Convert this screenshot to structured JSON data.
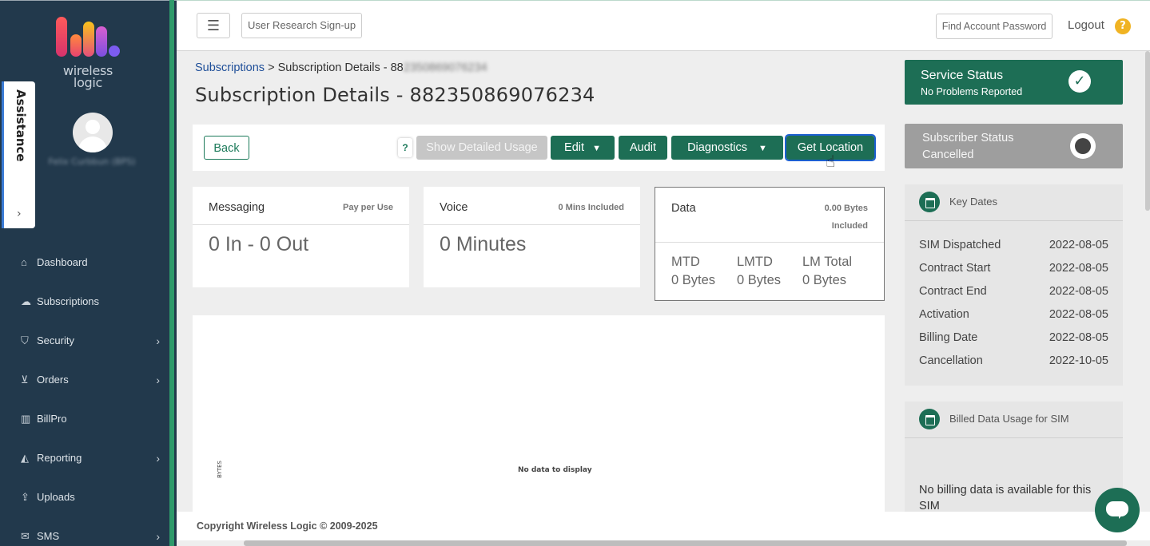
{
  "sidebar": {
    "logo_text_line1": "wireless",
    "logo_text_line2": "logic",
    "user_name": "Felix Curbbun (BPS)",
    "assistance_label": "Assistance",
    "items": [
      {
        "label": "Dashboard",
        "icon": "home-icon"
      },
      {
        "label": "Subscriptions",
        "icon": "cloud-icon"
      },
      {
        "label": "Security",
        "icon": "shield-icon"
      },
      {
        "label": "Orders",
        "icon": "basket-icon"
      },
      {
        "label": "BillPro",
        "icon": "bar-chart-icon"
      },
      {
        "label": "Reporting",
        "icon": "area-chart-icon"
      },
      {
        "label": "Uploads",
        "icon": "upload-icon"
      },
      {
        "label": "SMS",
        "icon": "envelope-icon"
      }
    ]
  },
  "topbar": {
    "research_label": "User Research Sign-up",
    "find_password_label": "Find Account Password",
    "logout_label": "Logout",
    "help": "?"
  },
  "breadcrumb": {
    "root": "Subscriptions",
    "sep": " > ",
    "current": "Subscription Details - 88",
    "redacted": "2350869076234"
  },
  "page_title": "Subscription Details - 882350869076234",
  "toolbar": {
    "back": "Back",
    "help": "?",
    "show_usage": "Show Detailed Usage",
    "edit": "Edit",
    "audit": "Audit",
    "diagnostics": "Diagnostics",
    "get_location": "Get Location"
  },
  "cards": {
    "messaging": {
      "title": "Messaging",
      "sub": "Pay per Use",
      "value": "0 In - 0 Out"
    },
    "voice": {
      "title": "Voice",
      "sub": "0 Mins Included",
      "value": "0 Minutes"
    },
    "data": {
      "title": "Data",
      "sub_line1": "0.00 Bytes",
      "sub_line2": "Included",
      "stats": [
        {
          "label": "MTD",
          "value": "0 Bytes"
        },
        {
          "label": "LMTD",
          "value": "0 Bytes"
        },
        {
          "label": "LM Total",
          "value": "0 Bytes"
        }
      ]
    }
  },
  "chart": {
    "y_label": "BYTES",
    "empty_message": "No data to display"
  },
  "footer": "Copyright Wireless Logic © 2009-2025",
  "service_status": {
    "title": "Service Status",
    "detail": "No Problems Reported"
  },
  "subscriber_status": {
    "title": "Subscriber Status",
    "detail": "Cancelled"
  },
  "key_dates": {
    "title": "Key Dates",
    "rows": [
      {
        "label": "SIM Dispatched",
        "value": "2022-08-05"
      },
      {
        "label": "Contract Start",
        "value": "2022-08-05"
      },
      {
        "label": "Contract End",
        "value": "2022-08-05"
      },
      {
        "label": "Activation",
        "value": "2022-08-05"
      },
      {
        "label": "Billing Date",
        "value": "2022-08-05"
      },
      {
        "label": "Cancellation",
        "value": "2022-10-05"
      }
    ]
  },
  "billed_usage": {
    "title": "Billed Data Usage for SIM",
    "message": "No billing data is available for this SIM"
  },
  "colors": {
    "brand_green": "#1d6e55",
    "sidebar": "#22394c",
    "link": "#1f4f99",
    "help": "#f0b323"
  }
}
